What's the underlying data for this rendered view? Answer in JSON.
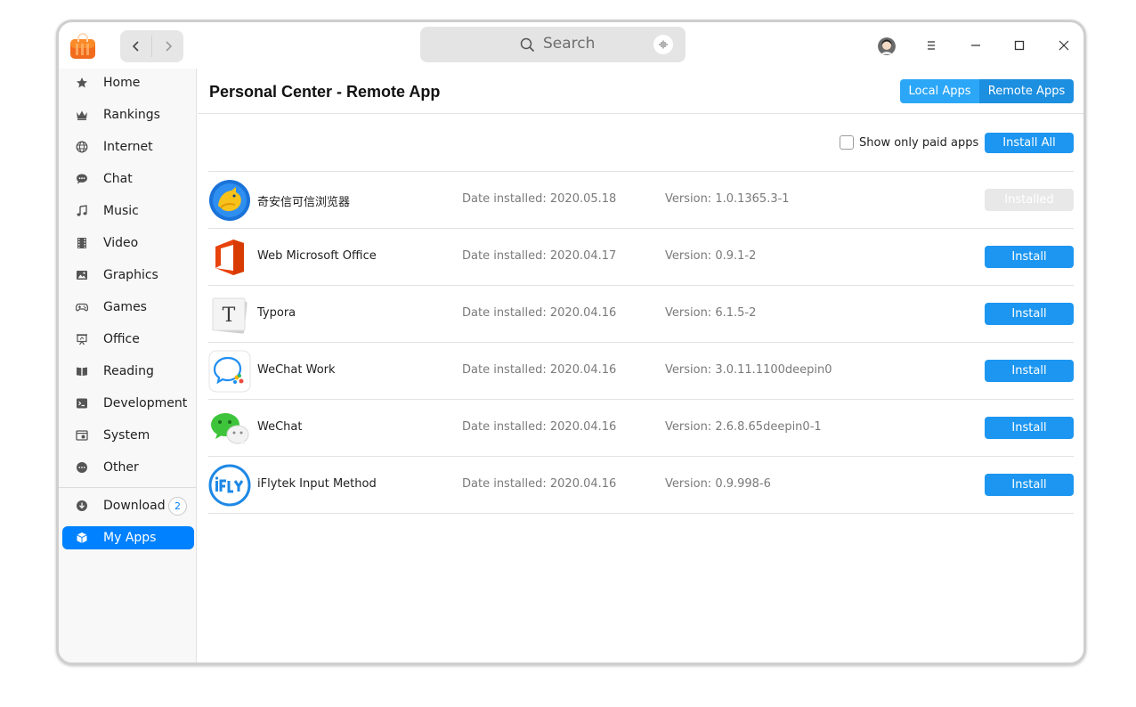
{
  "titlebar": {
    "search_placeholder": "Search"
  },
  "sidebar": {
    "items": [
      {
        "label": "Home",
        "icon": "star-icon"
      },
      {
        "label": "Rankings",
        "icon": "crown-icon"
      },
      {
        "label": "Internet",
        "icon": "globe-icon"
      },
      {
        "label": "Chat",
        "icon": "chat-bubble-icon"
      },
      {
        "label": "Music",
        "icon": "music-note-icon"
      },
      {
        "label": "Video",
        "icon": "film-icon"
      },
      {
        "label": "Graphics",
        "icon": "image-icon"
      },
      {
        "label": "Games",
        "icon": "gamepad-icon"
      },
      {
        "label": "Office",
        "icon": "presentation-icon"
      },
      {
        "label": "Reading",
        "icon": "book-icon"
      },
      {
        "label": "Development",
        "icon": "terminal-icon"
      },
      {
        "label": "System",
        "icon": "system-icon"
      },
      {
        "label": "Other",
        "icon": "more-dots-icon"
      }
    ],
    "download": {
      "label": "Download",
      "count": "2"
    },
    "my_apps": {
      "label": "My Apps"
    }
  },
  "main": {
    "title": "Personal Center - Remote App",
    "tabs": [
      "Local Apps",
      "Remote Apps"
    ],
    "paid_only_label": "Show only paid apps",
    "install_all_label": "Install All",
    "apps": [
      {
        "name": "奇安信可信浏览器",
        "date": "Date installed: 2020.05.18",
        "version": "Version: 1.0.1365.3-1",
        "action": "Installed",
        "state": "installed"
      },
      {
        "name": "Web Microsoft Office",
        "date": "Date installed: 2020.04.17",
        "version": "Version: 0.9.1-2",
        "action": "Install",
        "state": "install"
      },
      {
        "name": "Typora",
        "date": "Date installed: 2020.04.16",
        "version": "Version: 6.1.5-2",
        "action": "Install",
        "state": "install"
      },
      {
        "name": "WeChat Work",
        "date": "Date installed: 2020.04.16",
        "version": "Version: 3.0.11.1100deepin0",
        "action": "Install",
        "state": "install"
      },
      {
        "name": "WeChat",
        "date": "Date installed: 2020.04.16",
        "version": "Version: 2.6.8.65deepin0-1",
        "action": "Install",
        "state": "install"
      },
      {
        "name": "iFlytek Input Method",
        "date": "Date installed: 2020.04.16",
        "version": "Version: 0.9.998-6",
        "action": "Install",
        "state": "install"
      }
    ]
  },
  "colors": {
    "accent": "#0081ff",
    "button": "#1c96f0",
    "sidebar_bg": "#f8f8f8"
  }
}
